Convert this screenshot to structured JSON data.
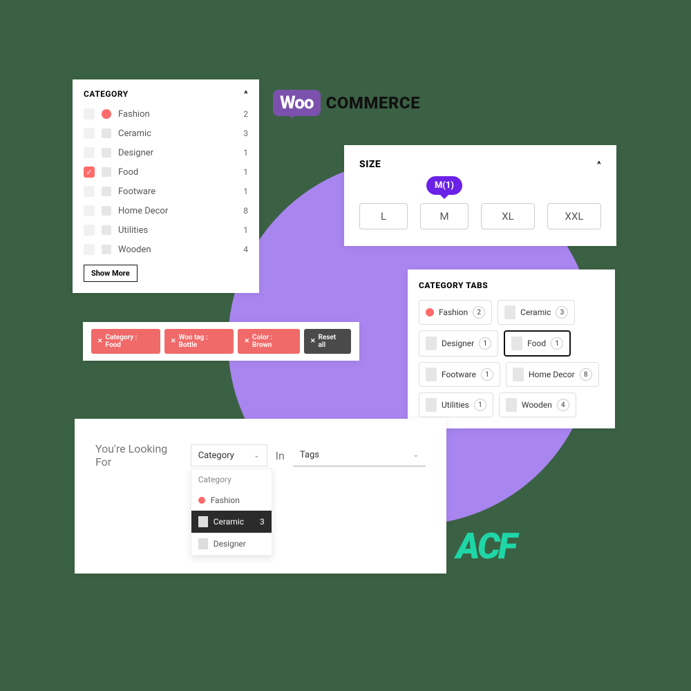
{
  "woo_logo": {
    "bubble": "Woo",
    "text": "COMMERCE"
  },
  "acf_logo": "ACF",
  "category_panel": {
    "title": "CATEGORY",
    "items": [
      {
        "label": "Fashion",
        "count": "2",
        "checked": false,
        "swatch": "pink"
      },
      {
        "label": "Ceramic",
        "count": "3",
        "checked": false,
        "swatch": "thumb"
      },
      {
        "label": "Designer",
        "count": "1",
        "checked": false,
        "swatch": "thumb"
      },
      {
        "label": "Food",
        "count": "1",
        "checked": true,
        "swatch": "thumb"
      },
      {
        "label": "Footware",
        "count": "1",
        "checked": false,
        "swatch": "thumb"
      },
      {
        "label": "Home Decor",
        "count": "8",
        "checked": false,
        "swatch": "thumb"
      },
      {
        "label": "Utilities",
        "count": "1",
        "checked": false,
        "swatch": "thumb"
      },
      {
        "label": "Wooden",
        "count": "4",
        "checked": false,
        "swatch": "thumb"
      }
    ],
    "show_more": "Show More"
  },
  "size_panel": {
    "title": "SIZE",
    "tooltip": "M(1)",
    "options": [
      "L",
      "M",
      "XL",
      "XXL"
    ]
  },
  "chips": {
    "items": [
      {
        "label": "Category : Food",
        "style": "red"
      },
      {
        "label": "Woo tag : Bottle",
        "style": "red"
      },
      {
        "label": "Color : Brown",
        "style": "red"
      },
      {
        "label": "Reset all",
        "style": "dark"
      }
    ]
  },
  "tabs_panel": {
    "title": "CATEGORY TABS",
    "items": [
      {
        "label": "Fashion",
        "count": "2",
        "swatch": "pink",
        "active": false
      },
      {
        "label": "Ceramic",
        "count": "3",
        "swatch": "thumb",
        "active": false
      },
      {
        "label": "Designer",
        "count": "1",
        "swatch": "thumb",
        "active": false
      },
      {
        "label": "Food",
        "count": "1",
        "swatch": "thumb",
        "active": true
      },
      {
        "label": "Footware",
        "count": "1",
        "swatch": "thumb",
        "active": false
      },
      {
        "label": "Home Decor",
        "count": "8",
        "swatch": "thumb",
        "active": false
      },
      {
        "label": "Utilities",
        "count": "1",
        "swatch": "thumb",
        "active": false
      },
      {
        "label": "Wooden",
        "count": "4",
        "swatch": "thumb",
        "active": false
      }
    ]
  },
  "lookfor_panel": {
    "prefix": "You're Looking For",
    "mid": "In",
    "select1": {
      "value": "Category"
    },
    "select2": {
      "value": "Tags"
    },
    "dropdown": {
      "header": "Category",
      "options": [
        {
          "label": "Fashion",
          "swatch": "pink",
          "selected": false
        },
        {
          "label": "Ceramic",
          "swatch": "thumb",
          "selected": true,
          "count": "3"
        },
        {
          "label": "Designer",
          "swatch": "thumb",
          "selected": false
        }
      ]
    }
  }
}
